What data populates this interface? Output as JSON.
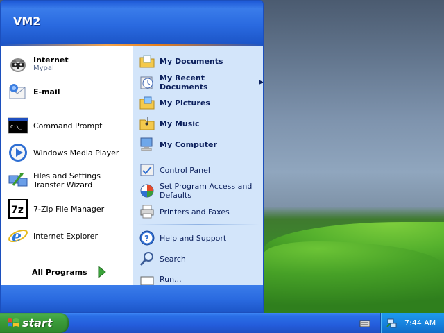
{
  "start_menu": {
    "user_name": "VM2",
    "pinned": [
      {
        "label": "Internet",
        "sub": "Mypal",
        "icon": "mypal-raccoon-icon"
      },
      {
        "label": "E-mail",
        "icon": "email-icon"
      }
    ],
    "recent": [
      {
        "label": "Command Prompt",
        "icon": "command-prompt-icon"
      },
      {
        "label": "Windows Media Player",
        "icon": "media-player-icon"
      },
      {
        "label": "Files and Settings Transfer Wizard",
        "icon": "transfer-wizard-icon"
      },
      {
        "label": "7-Zip File Manager",
        "icon": "7zip-icon"
      },
      {
        "label": "Internet Explorer",
        "icon": "internet-explorer-icon"
      }
    ],
    "all_programs": "All Programs",
    "places": [
      {
        "label": "My Documents",
        "icon": "folder-documents-icon"
      },
      {
        "label": "My Recent Documents",
        "icon": "recent-documents-icon"
      },
      {
        "label": "My Pictures",
        "icon": "folder-pictures-icon"
      },
      {
        "label": "My Music",
        "icon": "folder-music-icon"
      },
      {
        "label": "My Computer",
        "icon": "my-computer-icon"
      }
    ],
    "settings": [
      {
        "label": "Control Panel",
        "icon": "control-panel-icon"
      },
      {
        "label": "Set Program Access and Defaults",
        "icon": "program-access-icon"
      },
      {
        "label": "Printers and Faxes",
        "icon": "printer-icon"
      }
    ],
    "help": [
      {
        "label": "Help and Support",
        "icon": "help-icon"
      },
      {
        "label": "Search",
        "icon": "search-icon"
      },
      {
        "label": "Run...",
        "icon": "run-icon"
      }
    ]
  },
  "taskbar": {
    "start_label": "start",
    "clock": "7:44 AM",
    "tray_icons": [
      "keyboard-icon",
      "network-icon"
    ]
  }
}
